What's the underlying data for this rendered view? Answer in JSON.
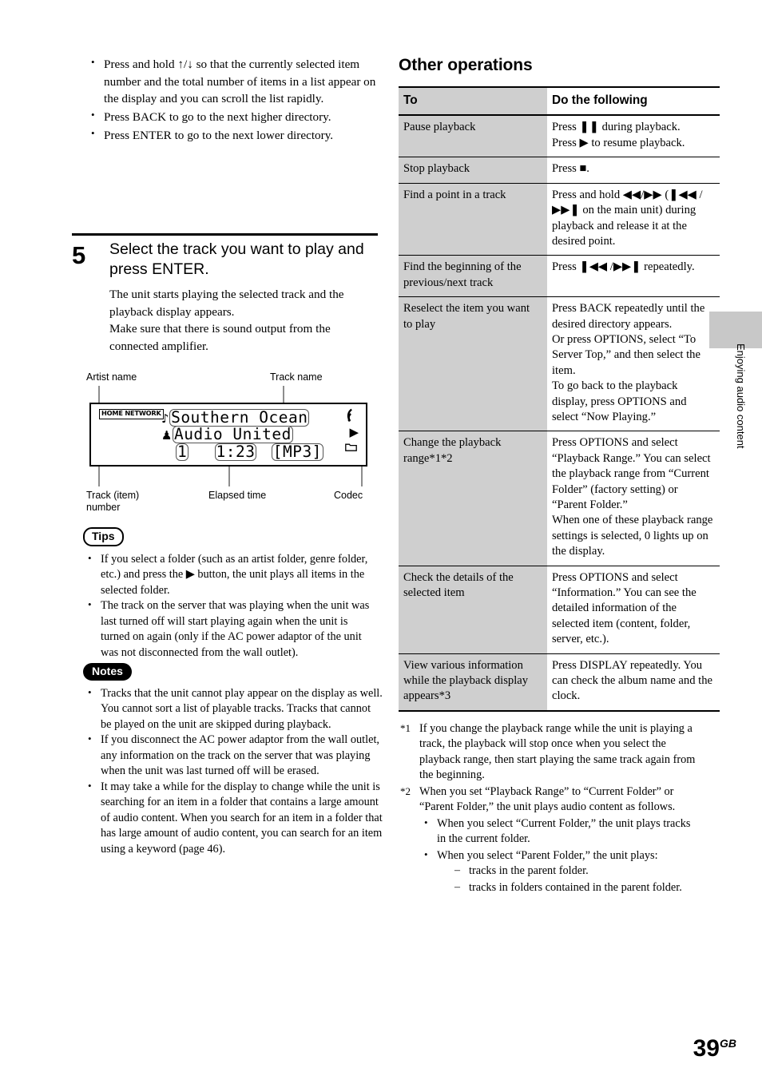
{
  "page": {
    "number": "39",
    "region": "GB"
  },
  "side_tab": {
    "label": "Enjoying audio content"
  },
  "left_column": {
    "top_bullets": [
      "Press and hold ↑/↓ so that the currently selected item number and the total number of items in a list appear on the display and you can scroll the list rapidly.",
      "Press BACK to go to the next higher directory.",
      "Press ENTER to go to the next lower directory."
    ],
    "step": {
      "number": "5",
      "title": "Select the track you want to play and press ENTER.",
      "body": "The unit starts playing the selected track and the playback display appears.\nMake sure that there is sound output from the connected amplifier."
    },
    "figure": {
      "labels": {
        "artist_name": "Artist name",
        "track_name": "Track name",
        "track_number": "Track (item)\nnumber",
        "elapsed_time": "Elapsed time",
        "codec": "Codec"
      },
      "display": {
        "source_badge": "HOME NETWORK",
        "track_name": "Southern Ocean",
        "artist_name": "Audio United",
        "track_number": "1",
        "elapsed_time": "1:23",
        "codec": "[MP3]",
        "note_icon": "♪",
        "person_icon": "♟",
        "wifi_icon": "wifi-icon",
        "play_icon": "▶",
        "folder_icon": "὜0"
      }
    },
    "tips": {
      "badge": "Tips",
      "items": [
        "If you select a folder (such as an artist folder, genre folder, etc.) and press the ▶ button, the unit plays all items in the selected folder.",
        "The track on the server that was playing when the unit was last turned off will start playing again when the unit is turned on again (only if the AC power adaptor of the unit was not disconnected from the wall outlet)."
      ]
    },
    "notes": {
      "badge": "Notes",
      "items": [
        "Tracks that the unit cannot play appear on the display as well. You cannot sort a list of playable tracks. Tracks that cannot be played on the unit are skipped during playback.",
        "If you disconnect the AC power adaptor from the wall outlet, any information on the track on the server that was playing when the unit was last turned off will be erased.",
        "It may take a while for the display to change while the unit is searching for an item in a folder that contains a large amount of audio content. When you search for an item in a folder that has large amount of audio content, you can search for an item using a keyword (page 46)."
      ]
    }
  },
  "right_column": {
    "title": "Other operations",
    "table": {
      "headers": {
        "col1": "To",
        "col2": "Do the following"
      },
      "rows": [
        {
          "to": "Pause playback",
          "do": "Press ❚❚ during playback.\nPress ▶ to resume playback."
        },
        {
          "to": "Stop playback",
          "do": "Press ■."
        },
        {
          "to": "Find a point in a track",
          "do": "Press and hold ◀◀/▶▶ (❚◀◀ /▶▶❚ on the main unit) during playback and release it at the desired point."
        },
        {
          "to": "Find the beginning of the previous/next track",
          "do": "Press ❚◀◀ /▶▶❚ repeatedly."
        },
        {
          "to": "Reselect the item you want to play",
          "do": "Press BACK repeatedly until the desired directory appears.\nOr press OPTIONS, select “To Server Top,” and then select the item.\nTo go back to the playback display, press OPTIONS and select “Now Playing.”"
        },
        {
          "to": "Change the playback range*1*2",
          "do": "Press OPTIONS and select “Playback Range.” You can select the playback range from “Current Folder” (factory setting) or “Parent Folder.”\nWhen one of these playback range settings is selected, ὜0 lights up on the display."
        },
        {
          "to": "Check the details of the selected item",
          "do": "Press OPTIONS and select “Information.” You can see the detailed information of the selected item (content, folder, server, etc.)."
        },
        {
          "to": "View various information while the playback display appears*3",
          "do": "Press DISPLAY repeatedly. You can check the album name and the clock."
        }
      ]
    },
    "footnotes": [
      {
        "marker": "*1",
        "text": "If you change the playback range while the unit is playing a track, the playback will stop once when you select the playback range, then start playing the same track again from the beginning."
      },
      {
        "marker": "*2",
        "text": "When you set “Playback Range” to “Current Folder” or “Parent Folder,” the unit plays audio content as follows.",
        "bullets": [
          {
            "text": "When you select “Current Folder,” the unit plays tracks in the current folder."
          },
          {
            "text": "When you select “Parent Folder,” the unit plays:",
            "subitems": [
              "tracks in the parent folder.",
              "tracks in folders contained in the parent folder."
            ]
          }
        ]
      }
    ]
  }
}
